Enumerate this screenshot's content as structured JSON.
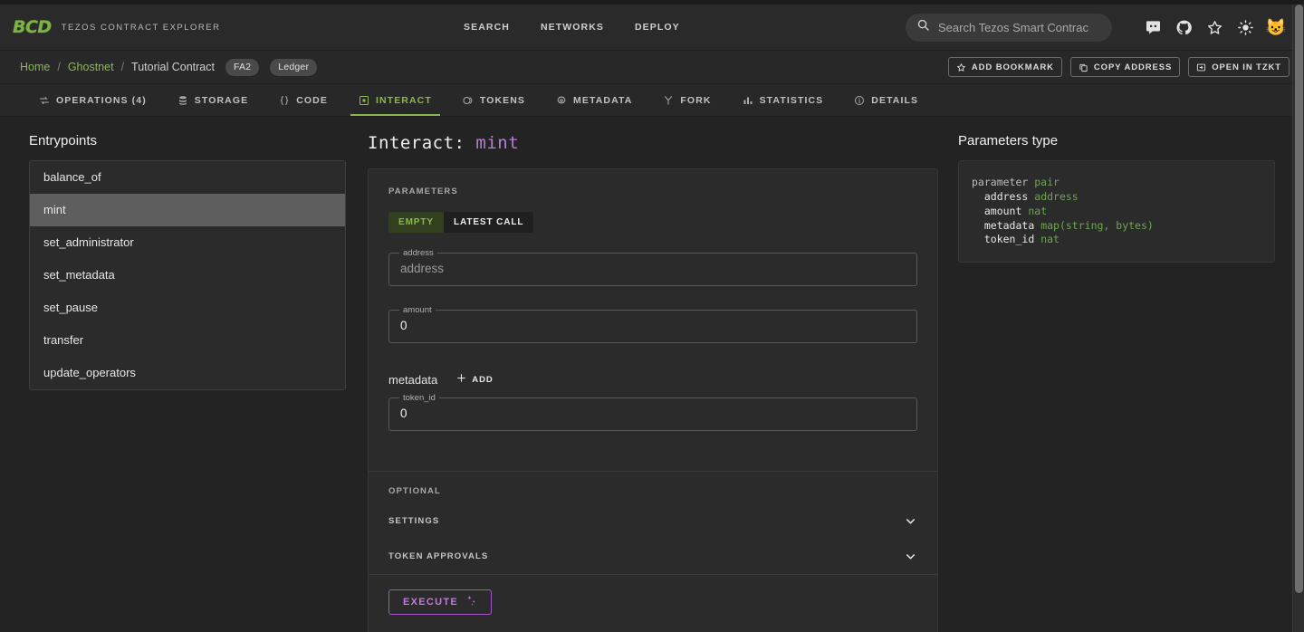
{
  "header": {
    "logo": "BCD",
    "tagline": "TEZOS CONTRACT EXPLORER",
    "nav": [
      {
        "label": "SEARCH"
      },
      {
        "label": "NETWORKS"
      },
      {
        "label": "DEPLOY"
      }
    ],
    "search": {
      "placeholder": "Search Tezos Smart Contrac",
      "value": "",
      "icon": "search-icon"
    },
    "icons": [
      {
        "name": "discord-icon"
      },
      {
        "name": "github-icon"
      },
      {
        "name": "star-icon"
      },
      {
        "name": "sun-theme-icon"
      },
      {
        "name": "cat-crown-avatar",
        "glyph": "😺"
      }
    ]
  },
  "breadcrumb": {
    "items": [
      {
        "label": "Home",
        "type": "link"
      },
      {
        "label": "Ghostnet",
        "type": "link"
      },
      {
        "label": "Tutorial Contract",
        "type": "current"
      }
    ],
    "separator": "/",
    "chips": [
      "FA2",
      "Ledger"
    ],
    "actions": [
      {
        "label": "ADD BOOKMARK",
        "icon": "star-icon"
      },
      {
        "label": "COPY ADDRESS",
        "icon": "copy-icon"
      },
      {
        "label": "OPEN IN TZKT",
        "icon": "external-link-icon"
      }
    ]
  },
  "tabs": [
    {
      "label": "OPERATIONS (4)",
      "icon": "transfer-arrows-icon",
      "active": false
    },
    {
      "label": "STORAGE",
      "icon": "database-icon",
      "active": false
    },
    {
      "label": "CODE",
      "icon": "braces-icon",
      "active": false
    },
    {
      "label": "INTERACT",
      "icon": "play-box-icon",
      "active": true
    },
    {
      "label": "TOKENS",
      "icon": "coins-icon",
      "active": false
    },
    {
      "label": "METADATA",
      "icon": "gear-icon",
      "active": false
    },
    {
      "label": "FORK",
      "icon": "fork-icon",
      "active": false
    },
    {
      "label": "STATISTICS",
      "icon": "bar-chart-icon",
      "active": false
    },
    {
      "label": "DETAILS",
      "icon": "info-circle-icon",
      "active": false
    }
  ],
  "entrypoints": {
    "title": "Entrypoints",
    "selected": "mint",
    "items": [
      {
        "label": "balance_of"
      },
      {
        "label": "mint"
      },
      {
        "label": "set_administrator"
      },
      {
        "label": "set_metadata"
      },
      {
        "label": "set_pause"
      },
      {
        "label": "transfer"
      },
      {
        "label": "update_operators"
      }
    ]
  },
  "interact": {
    "title_prefix": "Interact:",
    "entrypoint": "mint",
    "parameters_label": "PARAMETERS",
    "source_toggle": {
      "options": [
        "EMPTY",
        "LATEST CALL"
      ],
      "selected": "EMPTY"
    },
    "fields": [
      {
        "label": "address",
        "value": "",
        "placeholder": "address"
      },
      {
        "label": "amount",
        "value": "0",
        "placeholder": ""
      }
    ],
    "metadata": {
      "name": "metadata",
      "add_label": "ADD",
      "add_icon": "plus-icon",
      "field": {
        "label": "token_id",
        "value": "0",
        "placeholder": ""
      }
    },
    "optional_label": "OPTIONAL",
    "accordions": [
      {
        "label": "SETTINGS",
        "icon": "chevron-down-icon",
        "expanded": false
      },
      {
        "label": "TOKEN APPROVALS",
        "icon": "chevron-down-icon",
        "expanded": false
      }
    ],
    "execute": {
      "label": "EXECUTE",
      "icon": "magic-wand-icon"
    }
  },
  "parameters_type": {
    "title": "Parameters type",
    "lines": [
      {
        "indent": 0,
        "tokens": [
          {
            "t": "parameter",
            "c": "kw"
          },
          {
            "t": " ",
            "c": "nm"
          },
          {
            "t": "pair",
            "c": "ty"
          }
        ]
      },
      {
        "indent": 1,
        "tokens": [
          {
            "t": "address",
            "c": "nm"
          },
          {
            "t": " ",
            "c": "nm"
          },
          {
            "t": "address",
            "c": "ty"
          }
        ]
      },
      {
        "indent": 1,
        "tokens": [
          {
            "t": "amount",
            "c": "nm"
          },
          {
            "t": " ",
            "c": "nm"
          },
          {
            "t": "nat",
            "c": "ty"
          }
        ]
      },
      {
        "indent": 1,
        "tokens": [
          {
            "t": "metadata",
            "c": "nm"
          },
          {
            "t": " ",
            "c": "nm"
          },
          {
            "t": "map(string, bytes)",
            "c": "ty"
          }
        ]
      },
      {
        "indent": 1,
        "tokens": [
          {
            "t": "token_id",
            "c": "nm"
          },
          {
            "t": " ",
            "c": "nm"
          },
          {
            "t": "nat",
            "c": "ty"
          }
        ]
      }
    ]
  },
  "colors": {
    "accent_green": "#8ab84f",
    "accent_purple": "#b47fd6",
    "bg": "#232323",
    "panel": "#2b2b2b"
  }
}
